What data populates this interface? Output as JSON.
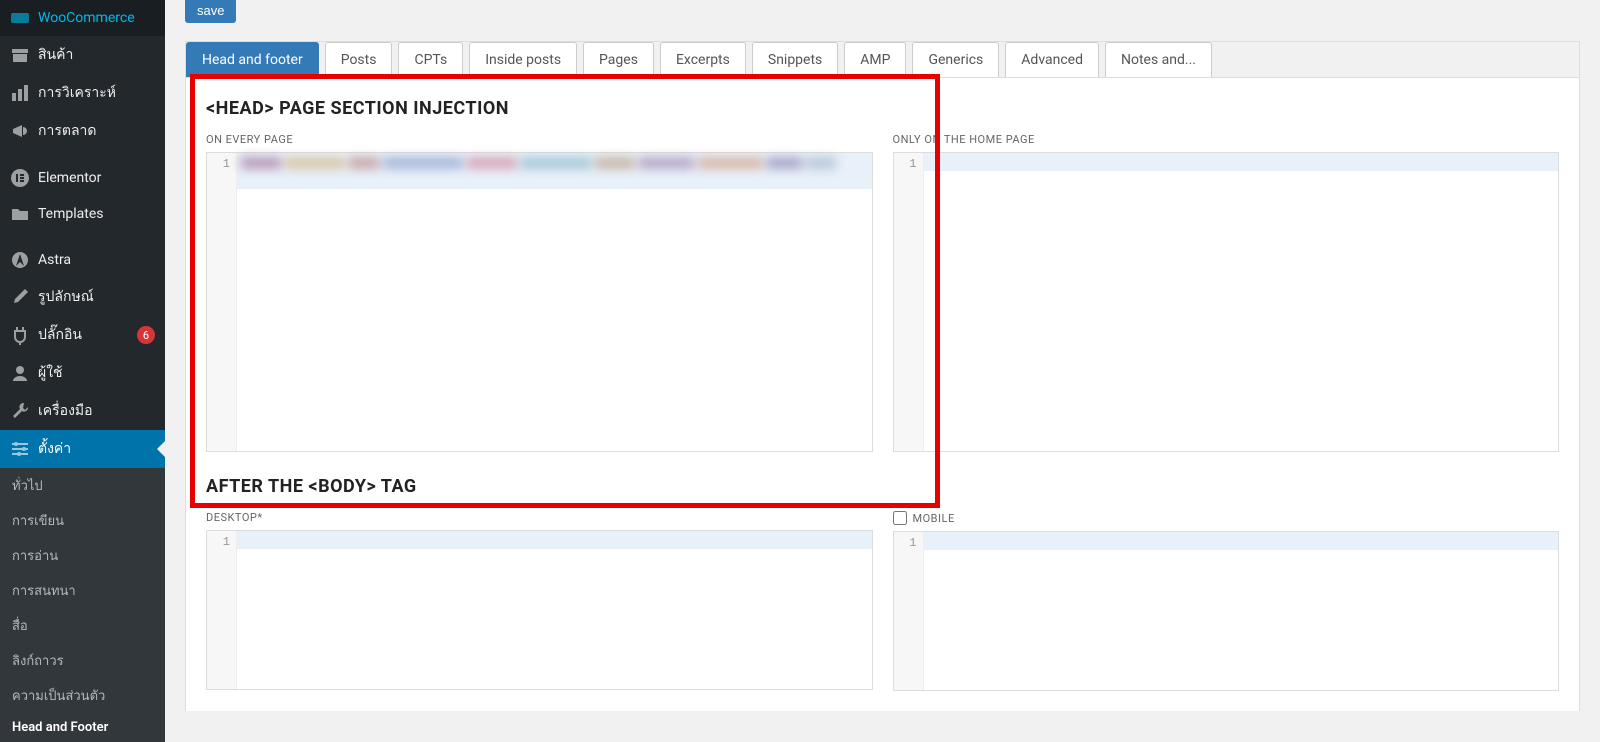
{
  "sidebar": {
    "items": [
      {
        "label": "WooCommerce",
        "icon": "woo"
      },
      {
        "label": "สินค้า",
        "icon": "archive"
      },
      {
        "label": "การวิเคราะห์",
        "icon": "chart"
      },
      {
        "label": "การตลาด",
        "icon": "megaphone"
      },
      {
        "label": "Elementor",
        "icon": "elementor"
      },
      {
        "label": "Templates",
        "icon": "folder"
      },
      {
        "label": "Astra",
        "icon": "astra"
      },
      {
        "label": "รูปลักษณ์",
        "icon": "brush"
      },
      {
        "label": "ปลั๊กอิน",
        "icon": "plug",
        "badge": "6"
      },
      {
        "label": "ผู้ใช้",
        "icon": "user"
      },
      {
        "label": "เครื่องมือ",
        "icon": "wrench"
      },
      {
        "label": "ตั้งค่า",
        "icon": "sliders",
        "active": true
      }
    ],
    "sub": [
      {
        "label": "ทั่วไป"
      },
      {
        "label": "การเขียน"
      },
      {
        "label": "การอ่าน"
      },
      {
        "label": "การสนทนา"
      },
      {
        "label": "สื่อ"
      },
      {
        "label": "ลิงก์ถาวร"
      },
      {
        "label": "ความเป็นส่วนตัว"
      },
      {
        "label": "Head and Footer",
        "current": true
      }
    ]
  },
  "save_label": "save",
  "tabs": [
    {
      "label": "Head and footer",
      "active": true
    },
    {
      "label": "Posts"
    },
    {
      "label": "CPTs"
    },
    {
      "label": "Inside posts"
    },
    {
      "label": "Pages"
    },
    {
      "label": "Excerpts"
    },
    {
      "label": "Snippets"
    },
    {
      "label": "AMP"
    },
    {
      "label": "Generics"
    },
    {
      "label": "Advanced"
    },
    {
      "label": "Notes and..."
    }
  ],
  "section1": {
    "title": "<HEAD> PAGE SECTION INJECTION",
    "left_label": "ON EVERY PAGE",
    "right_label": "ONLY ON THE HOME PAGE"
  },
  "section2": {
    "title": "AFTER THE <BODY> TAG",
    "left_label": "DESKTOP*",
    "right_label": "MOBILE"
  },
  "line_num": "1"
}
